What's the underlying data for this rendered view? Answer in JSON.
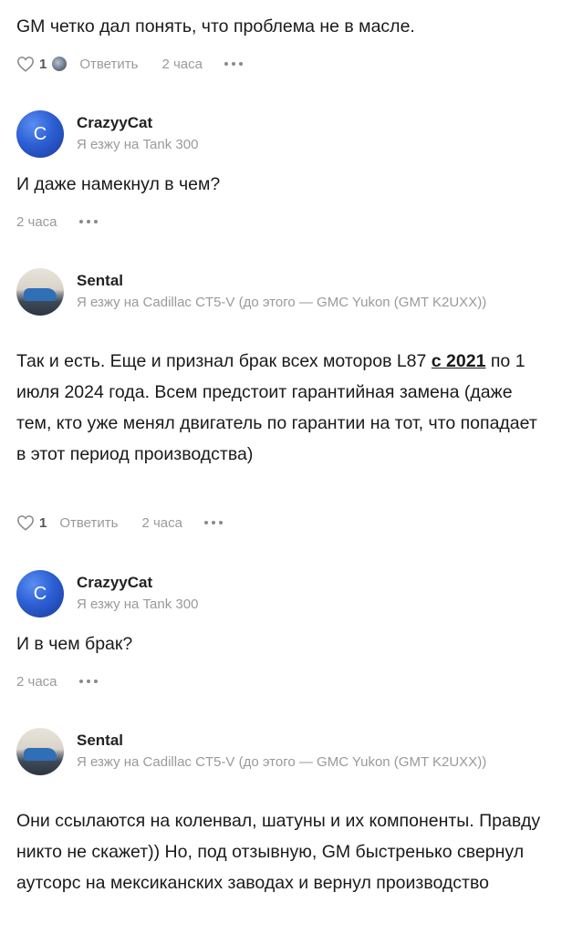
{
  "comments": [
    {
      "text": "GM четко дал понять, что проблема не в масле.",
      "likes": "1",
      "reply_label": "Ответить",
      "time": "2 часа"
    },
    {
      "author": "CrazyyCat",
      "avatar_letter": "C",
      "car": "Я езжу на Tank 300",
      "text": "И даже намекнул в чем?",
      "time": "2 часа"
    },
    {
      "author": "Sental",
      "car": "Я езжу на Cadillac CT5-V (до этого — GMC Yukon (GMT K2UXX))",
      "text_before": "Так и есть. Еще и признал брак всех моторов L87 ",
      "link": "с 2021",
      "text_after": " по 1 июля 2024 года. Всем предстоит гарантийная замена (даже тем, кто уже менял двигатель по гарантии на тот, что попадает в этот период производства)",
      "likes": "1",
      "reply_label": "Ответить",
      "time": "2 часа"
    },
    {
      "author": "CrazyyCat",
      "avatar_letter": "C",
      "car": "Я езжу на Tank 300",
      "text": "И в чем брак?",
      "time": "2 часа"
    },
    {
      "author": "Sental",
      "car": "Я езжу на Cadillac CT5-V (до этого — GMC Yukon (GMT K2UXX))",
      "text": "Они ссылаются на коленвал, шатуны и их компоненты. Правду никто не скажет)) Но, под отзывную, GM быстренько свернул аутсорс на мексиканских заводах и вернул производство"
    }
  ],
  "icons": {
    "like": "heart-icon",
    "more": "more-dots-icon"
  },
  "colors": {
    "avatar_blue": "#2c5fd4",
    "meta_gray": "#9a9a9a",
    "text": "#1a1a1a"
  }
}
